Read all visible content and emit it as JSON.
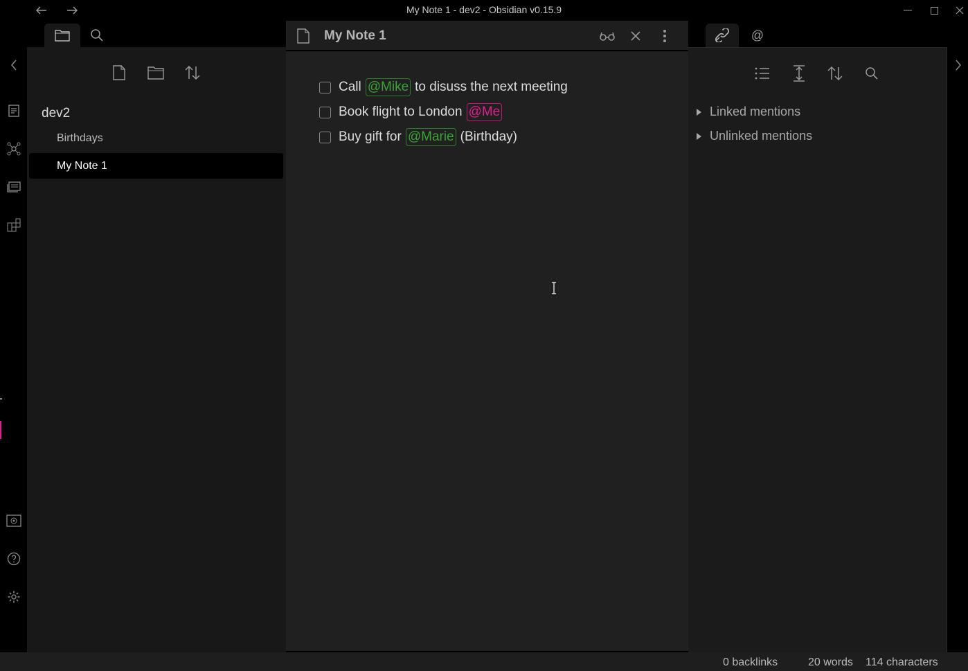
{
  "window": {
    "title": "My Note 1 - dev2 - Obsidian v0.15.9"
  },
  "left_sidebar": {
    "vault_name": "dev2",
    "files": [
      {
        "label": "Birthdays",
        "active": false
      },
      {
        "label": "My Note 1",
        "active": true
      }
    ]
  },
  "editor": {
    "note_title": "My Note 1",
    "tasks": [
      {
        "before": "Call",
        "mention": "@Mike",
        "mention_color": "green",
        "after": "to disuss the next meeting"
      },
      {
        "before": "Book flight to London",
        "mention": "@Me",
        "mention_color": "pink",
        "after": ""
      },
      {
        "before": "Buy gift for",
        "mention": "@Marie",
        "mention_color": "green",
        "after": "(Birthday)"
      }
    ]
  },
  "right_sidebar": {
    "tab_mention_symbol": "@",
    "groups": [
      {
        "label": "Linked mentions"
      },
      {
        "label": "Unlinked mentions"
      }
    ]
  },
  "status_bar": {
    "backlinks": "0 backlinks",
    "words": "20 words",
    "characters": "114 characters"
  },
  "colors": {
    "accent": "#e0208f",
    "mention_green": "#3aa336",
    "mention_pink": "#e0208f"
  }
}
